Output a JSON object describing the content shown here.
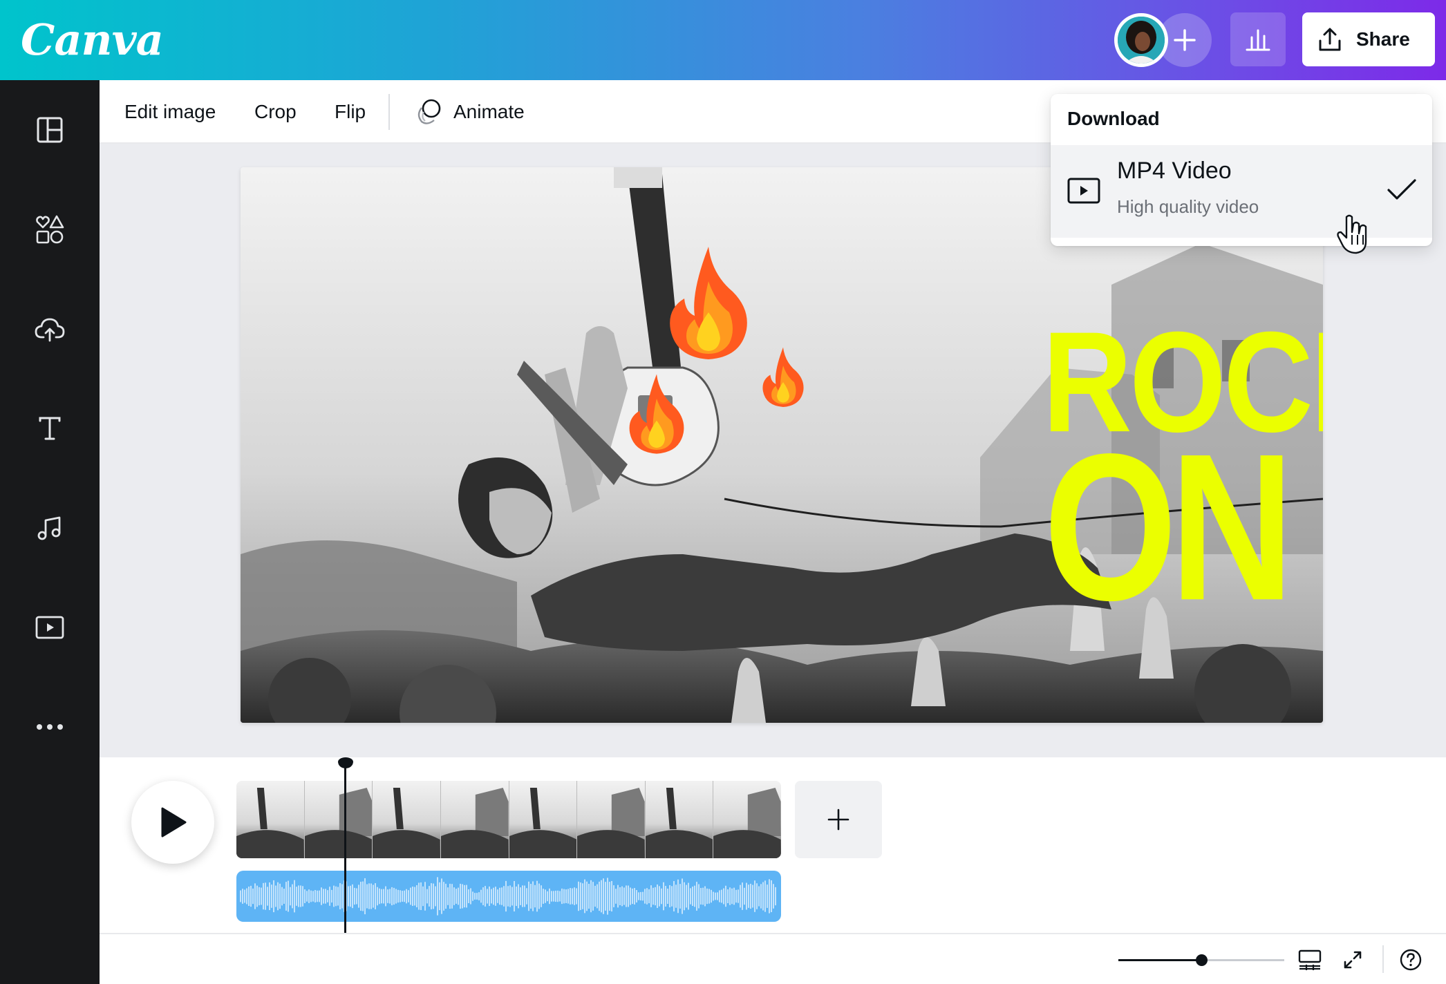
{
  "brand": {
    "name": "Canva"
  },
  "header": {
    "share_label": "Share",
    "colors": {
      "gradient_start": "#00c4cc",
      "gradient_end": "#7d2ae8"
    }
  },
  "sidebar": {
    "items": [
      {
        "icon": "layout-panel-icon"
      },
      {
        "icon": "elements-shapes-icon"
      },
      {
        "icon": "cloud-upload-icon"
      },
      {
        "icon": "text-icon"
      },
      {
        "icon": "music-note-icon"
      },
      {
        "icon": "video-play-icon"
      },
      {
        "icon": "more-dots-icon"
      }
    ]
  },
  "toolbar": {
    "edit_image": "Edit image",
    "crop": "Crop",
    "flip": "Flip",
    "animate": "Animate"
  },
  "design": {
    "headline_line1": "ROCK",
    "headline_line2": "ON",
    "headline_color": "#ebff00"
  },
  "download_menu": {
    "title": "Download",
    "option": {
      "title": "MP4 Video",
      "subtitle": "High quality video",
      "selected": true
    }
  },
  "timeline": {
    "playhead_fraction": 0.2,
    "audio_color": "#5eb4f5"
  },
  "footer": {
    "zoom_fraction": 0.5
  }
}
